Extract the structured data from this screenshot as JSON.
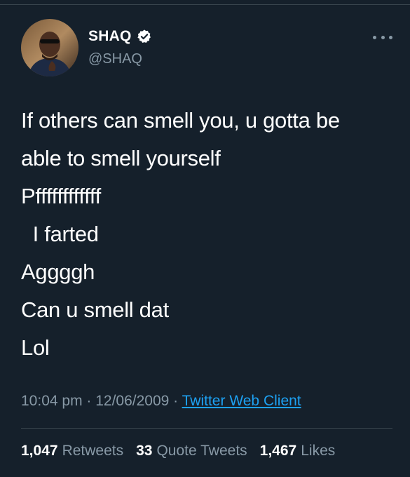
{
  "author": {
    "display_name": "SHAQ",
    "handle": "@SHAQ",
    "verified": true
  },
  "icons": {
    "verified": "verified-badge-icon",
    "more": "more-horizontal-icon"
  },
  "tweet": {
    "lines": [
      "If others can smell you, u gotta be",
      "able to smell yourself",
      "Pffffffffffff",
      "  I farted",
      "Aggggh",
      "Can u smell dat",
      "Lol"
    ]
  },
  "meta": {
    "time": "10:04 pm",
    "separator": " · ",
    "date": "12/06/2009",
    "source": "Twitter Web Client"
  },
  "stats": {
    "retweets_count": "1,047",
    "retweets_label": "Retweets",
    "quotes_count": "33",
    "quotes_label": "Quote Tweets",
    "likes_count": "1,467",
    "likes_label": "Likes"
  },
  "colors": {
    "background": "#15202b",
    "primary_text": "#ffffff",
    "secondary_text": "#8899a6",
    "link": "#1da1f2",
    "divider": "#38444d"
  }
}
